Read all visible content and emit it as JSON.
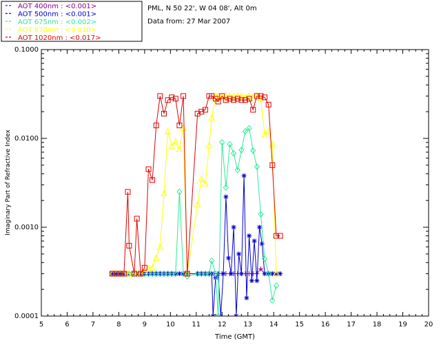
{
  "chart_data": {
    "type": "line",
    "header": {
      "site": "PML, N 50 22', W 04 08', Alt 0m",
      "date": "Data from: 27 Mar 2007"
    },
    "xlabel": "Time (GMT)",
    "ylabel": "Imaginary Part of Refractive Index",
    "xlim": [
      5,
      20
    ],
    "ylim": [
      0.0001,
      0.1
    ],
    "yscale": "log",
    "x_ticks": [
      "5",
      "6",
      "7",
      "8",
      "9",
      "10",
      "11",
      "12",
      "13",
      "14",
      "15",
      "16",
      "17",
      "18",
      "19",
      "20"
    ],
    "y_ticks": [
      "0.0001",
      "0.0010",
      "0.0100",
      "0.1000"
    ],
    "legend_position": "above plot, top-left",
    "series": [
      {
        "name": "AOT 400nm : <0.001>",
        "color": "#8b008b",
        "marker": "plus",
        "x": [
          7.75,
          7.9,
          8.05,
          8.2,
          8.35,
          8.4,
          8.6,
          8.7,
          8.85,
          9.0,
          9.15,
          9.3,
          9.45,
          9.6,
          9.75,
          9.9,
          10.05,
          10.2,
          10.35,
          10.5,
          10.65,
          11.05,
          11.2,
          11.35,
          11.5,
          11.6,
          11.7,
          11.85,
          12.0,
          12.15,
          12.3,
          12.45,
          12.6,
          12.75,
          12.9,
          13.05,
          13.2,
          13.35,
          13.5,
          13.65,
          13.8,
          13.95,
          14.1,
          14.25
        ],
        "y": [
          0.0003,
          0.0003,
          0.0003,
          0.0003,
          0.0003,
          0.0003,
          0.0003,
          0.0003,
          0.0003,
          0.0003,
          0.0003,
          0.0003,
          0.0003,
          0.0003,
          0.0003,
          0.0003,
          0.0003,
          0.0003,
          0.0003,
          0.0003,
          0.0003,
          0.0003,
          0.0003,
          0.0003,
          0.0003,
          0.0003,
          0.0003,
          0.0003,
          0.0003,
          0.0003,
          0.0003,
          0.0003,
          0.0003,
          0.0003,
          0.0003,
          0.0003,
          0.0003,
          0.0003,
          0.00034,
          0.0003,
          0.0003,
          0.0003,
          0.0003,
          0.0003
        ]
      },
      {
        "name": "AOT 500nm : <0.001>",
        "color": "#0000cd",
        "marker": "star",
        "x": [
          7.75,
          7.9,
          8.05,
          8.2,
          8.35,
          8.4,
          8.6,
          8.7,
          8.85,
          9.0,
          9.15,
          9.3,
          9.45,
          9.6,
          9.75,
          9.9,
          10.05,
          10.2,
          10.35,
          10.5,
          10.65,
          11.05,
          11.2,
          11.35,
          11.5,
          11.6,
          11.65,
          11.75,
          11.85,
          11.95,
          12.05,
          12.15,
          12.25,
          12.35,
          12.45,
          12.55,
          12.65,
          12.75,
          12.85,
          12.95,
          13.05,
          13.15,
          13.25,
          13.35,
          13.45,
          13.55,
          13.65,
          13.8,
          13.95,
          14.1,
          14.25
        ],
        "y": [
          0.0003,
          0.0003,
          0.0003,
          0.0003,
          0.0003,
          0.0003,
          0.0003,
          0.0003,
          0.0003,
          0.0003,
          0.0003,
          0.0003,
          0.0003,
          0.0003,
          0.0003,
          0.0003,
          0.0003,
          0.0003,
          0.0003,
          0.0003,
          0.0003,
          0.0003,
          0.0003,
          0.0003,
          0.0003,
          0.0003,
          0.0001,
          0.00027,
          0.0003,
          0.0001,
          0.0003,
          0.0022,
          0.00045,
          0.0003,
          0.001,
          0.0001,
          0.0005,
          0.0003,
          0.0038,
          0.00016,
          0.0008,
          0.00025,
          0.0007,
          0.00025,
          0.001,
          0.00065,
          0.0003,
          0.0003,
          0.0003,
          0.0003,
          0.0003
        ]
      },
      {
        "name": "AOT 675nm : <0.002>",
        "color": "#2ee89a",
        "marker": "diamond",
        "x": [
          7.75,
          7.9,
          8.05,
          8.2,
          8.35,
          8.4,
          8.6,
          8.7,
          8.85,
          9.0,
          9.15,
          9.3,
          9.45,
          9.6,
          9.75,
          9.9,
          10.05,
          10.2,
          10.35,
          10.5,
          10.65,
          11.05,
          11.2,
          11.35,
          11.5,
          11.6,
          11.75,
          11.85,
          12.0,
          12.15,
          12.3,
          12.45,
          12.6,
          12.75,
          12.9,
          13.05,
          13.2,
          13.35,
          13.5,
          13.65,
          13.8,
          13.95,
          14.1
        ],
        "y": [
          0.0003,
          0.0003,
          0.0003,
          0.0003,
          0.0003,
          0.0003,
          0.0003,
          0.0003,
          0.0003,
          0.0003,
          0.0003,
          0.0003,
          0.0003,
          0.0003,
          0.0003,
          0.0003,
          0.0003,
          0.0003,
          0.0025,
          0.0003,
          0.00028,
          0.0003,
          0.0003,
          0.0003,
          0.0003,
          0.00042,
          0.0003,
          0.0001,
          0.009,
          0.0028,
          0.0086,
          0.0068,
          0.0044,
          0.0074,
          0.012,
          0.013,
          0.0073,
          0.0048,
          0.0014,
          0.00044,
          0.0003,
          0.00015,
          0.00022
        ]
      },
      {
        "name": "AOT 870nm : <0.010>",
        "color": "#ffff00",
        "marker": "triangle",
        "x": [
          7.75,
          7.9,
          8.05,
          8.2,
          8.35,
          8.4,
          8.6,
          8.7,
          8.85,
          9.0,
          9.15,
          9.3,
          9.45,
          9.6,
          9.75,
          9.9,
          10.05,
          10.2,
          10.35,
          10.5,
          10.65,
          11.05,
          11.2,
          11.35,
          11.5,
          11.6,
          11.75,
          11.85,
          12.0,
          12.15,
          12.3,
          12.45,
          12.6,
          12.75,
          12.9,
          13.05,
          13.2,
          13.35,
          13.5,
          13.65,
          13.8,
          13.95,
          14.1
        ],
        "y": [
          0.0003,
          0.0003,
          0.0003,
          0.0003,
          0.0003,
          0.0003,
          0.0003,
          0.0003,
          0.0003,
          0.00032,
          0.00034,
          0.00035,
          0.00045,
          0.0006,
          0.0024,
          0.012,
          0.0082,
          0.0092,
          0.0076,
          0.013,
          0.0003,
          0.0018,
          0.0035,
          0.0031,
          0.0083,
          0.017,
          0.03,
          0.03,
          0.029,
          0.03,
          0.03,
          0.03,
          0.03,
          0.03,
          0.029,
          0.03,
          0.029,
          0.03,
          0.028,
          0.011,
          0.012,
          0.0085,
          0.0003
        ]
      },
      {
        "name": "AOT 1020nm : <0.017>",
        "color": "#e00000",
        "marker": "square",
        "x": [
          7.75,
          7.9,
          8.05,
          8.2,
          8.35,
          8.4,
          8.6,
          8.7,
          8.85,
          9.0,
          9.15,
          9.3,
          9.45,
          9.6,
          9.75,
          9.9,
          10.05,
          10.2,
          10.35,
          10.5,
          10.65,
          11.05,
          11.2,
          11.35,
          11.5,
          11.6,
          11.75,
          11.85,
          12.0,
          12.15,
          12.3,
          12.45,
          12.6,
          12.75,
          12.9,
          13.05,
          13.2,
          13.35,
          13.5,
          13.65,
          13.8,
          13.95,
          14.1,
          14.25
        ],
        "y": [
          0.0003,
          0.0003,
          0.0003,
          0.0003,
          0.0025,
          0.00062,
          0.0003,
          0.00125,
          0.0003,
          0.00035,
          0.0045,
          0.0034,
          0.014,
          0.03,
          0.019,
          0.027,
          0.029,
          0.028,
          0.014,
          0.03,
          0.0003,
          0.019,
          0.02,
          0.021,
          0.03,
          0.03,
          0.028,
          0.026,
          0.03,
          0.027,
          0.028,
          0.027,
          0.028,
          0.027,
          0.027,
          0.028,
          0.021,
          0.03,
          0.03,
          0.029,
          0.024,
          0.005,
          0.0008,
          0.0008
        ]
      }
    ]
  }
}
